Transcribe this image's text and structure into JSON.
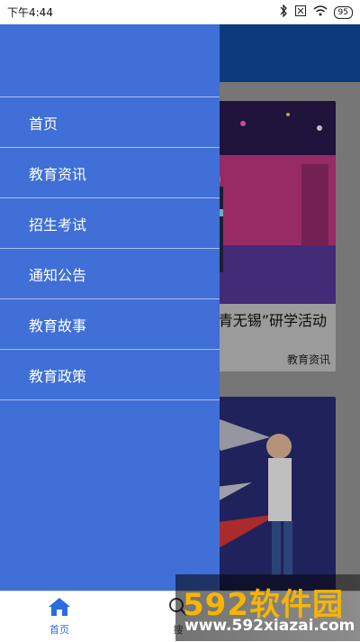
{
  "status_bar": {
    "time": "下午4:44",
    "battery": "95"
  },
  "drawer": {
    "items": [
      {
        "label": "首页"
      },
      {
        "label": "教育资讯"
      },
      {
        "label": "招生考试"
      },
      {
        "label": "通知公告"
      },
      {
        "label": "教育故事"
      },
      {
        "label": "教育政策"
      }
    ]
  },
  "cards": [
    {
      "title": "青无锡”研学活动",
      "tag": "教育资讯"
    }
  ],
  "tabbar": {
    "home_label": "首页",
    "search_label": "搜"
  },
  "watermark": {
    "title": "592软件园",
    "url": "www.592xiazai.com"
  },
  "colors": {
    "drawer_bg": "#3f6fd7",
    "accent": "#2a6be0",
    "banner": "#0f4fa6",
    "watermark_orange": "#f7b500"
  }
}
